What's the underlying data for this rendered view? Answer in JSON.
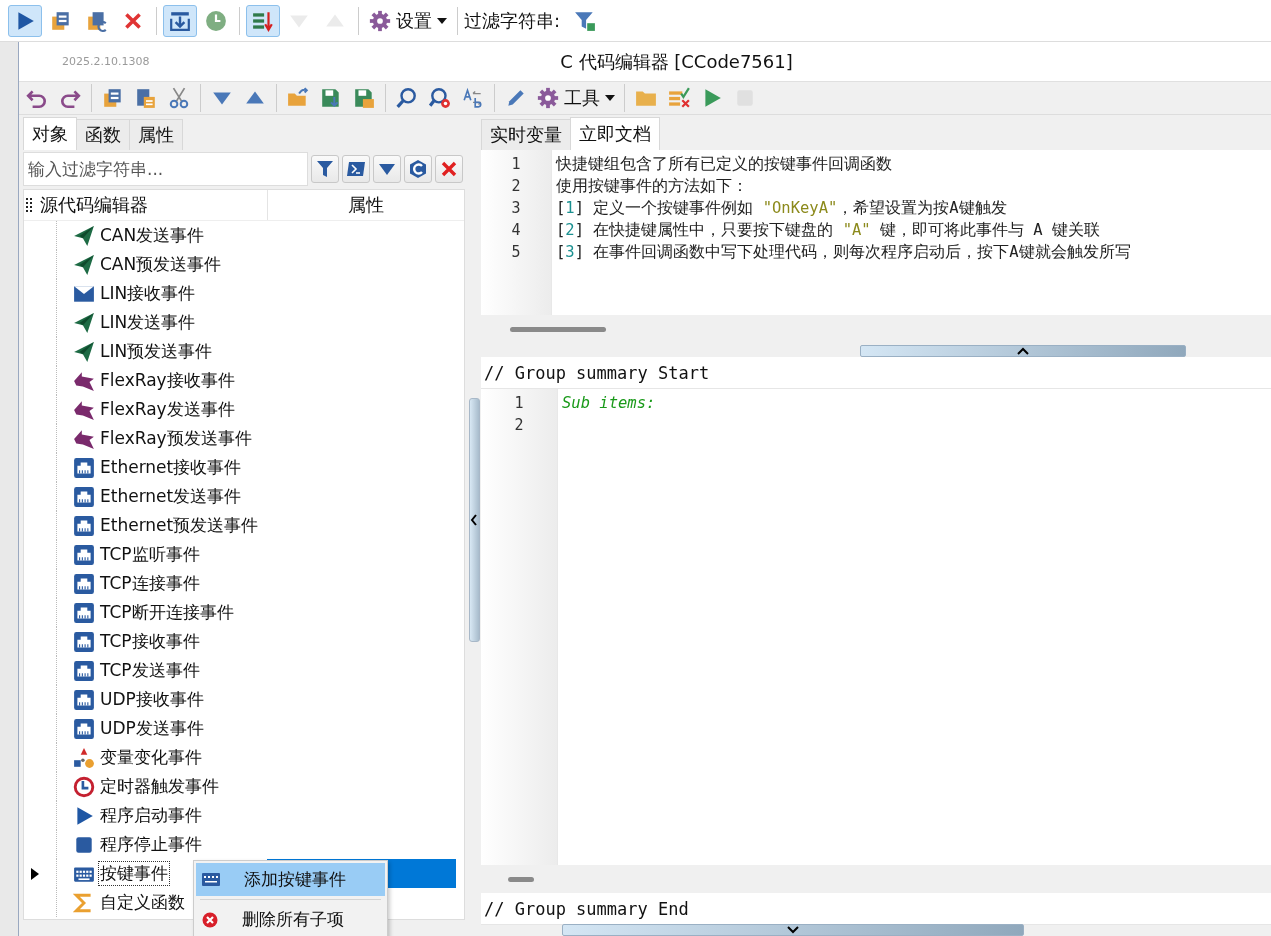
{
  "top_toolbar": {
    "buttons": [
      {
        "pressed": true,
        "disabled": false
      },
      {
        "pressed": false,
        "disabled": false
      },
      {
        "pressed": false,
        "disabled": false
      },
      {
        "pressed": false,
        "disabled": false
      },
      {
        "pressed": true,
        "disabled": false
      },
      {
        "pressed": false,
        "disabled": false
      },
      {
        "pressed": true,
        "disabled": false
      },
      {
        "pressed": false,
        "disabled": true
      },
      {
        "pressed": false,
        "disabled": true
      }
    ],
    "settings_menu": "设置",
    "filter_label": "过滤字符串:"
  },
  "window": {
    "version": "2025.2.10.1308",
    "title": "C 代码编辑器 [CCode7561]"
  },
  "editor_toolbar": {
    "buttons": [
      {
        "disabled": false
      },
      {
        "disabled": false
      },
      {
        "disabled": false
      },
      {
        "disabled": false
      },
      {
        "disabled": false
      },
      {
        "disabled": false
      },
      {
        "disabled": false
      },
      {
        "disabled": false
      },
      {
        "disabled": false
      },
      {
        "disabled": false
      },
      {
        "disabled": false
      },
      {
        "disabled": false
      },
      {
        "disabled": false
      },
      {
        "disabled": false
      },
      {
        "disabled": false
      },
      {
        "disabled": false
      },
      {
        "disabled": false
      },
      {
        "disabled": true
      }
    ],
    "tools_menu": "工具"
  },
  "left_tabs": [
    {
      "label": "对象",
      "selected": true
    },
    {
      "label": "函数",
      "selected": false
    },
    {
      "label": "属性",
      "selected": false
    }
  ],
  "filter": {
    "placeholder": "输入过滤字符串..."
  },
  "tree": {
    "columns": [
      "源代码编辑器",
      "属性"
    ],
    "items": [
      {
        "label": "CAN发送事件",
        "kind": "send",
        "selected": false,
        "expandable": false
      },
      {
        "label": "CAN预发送事件",
        "kind": "send",
        "selected": false,
        "expandable": false
      },
      {
        "label": "LIN接收事件",
        "kind": "receive",
        "selected": false,
        "expandable": false
      },
      {
        "label": "LIN发送事件",
        "kind": "send",
        "selected": false,
        "expandable": false
      },
      {
        "label": "LIN预发送事件",
        "kind": "send",
        "selected": false,
        "expandable": false
      },
      {
        "label": "FlexRay接收事件",
        "kind": "flexray",
        "selected": false,
        "expandable": false
      },
      {
        "label": "FlexRay发送事件",
        "kind": "flexray",
        "selected": false,
        "expandable": false
      },
      {
        "label": "FlexRay预发送事件",
        "kind": "flexray",
        "selected": false,
        "expandable": false
      },
      {
        "label": "Ethernet接收事件",
        "kind": "network",
        "selected": false,
        "expandable": false
      },
      {
        "label": "Ethernet发送事件",
        "kind": "network",
        "selected": false,
        "expandable": false
      },
      {
        "label": "Ethernet预发送事件",
        "kind": "network",
        "selected": false,
        "expandable": false
      },
      {
        "label": "TCP监听事件",
        "kind": "network",
        "selected": false,
        "expandable": false
      },
      {
        "label": "TCP连接事件",
        "kind": "network",
        "selected": false,
        "expandable": false
      },
      {
        "label": "TCP断开连接事件",
        "kind": "network",
        "selected": false,
        "expandable": false
      },
      {
        "label": "TCP接收事件",
        "kind": "network",
        "selected": false,
        "expandable": false
      },
      {
        "label": "TCP发送事件",
        "kind": "network",
        "selected": false,
        "expandable": false
      },
      {
        "label": "UDP接收事件",
        "kind": "network",
        "selected": false,
        "expandable": false
      },
      {
        "label": "UDP发送事件",
        "kind": "network",
        "selected": false,
        "expandable": false
      },
      {
        "label": "变量变化事件",
        "kind": "variable",
        "selected": false,
        "expandable": false
      },
      {
        "label": "定时器触发事件",
        "kind": "timer",
        "selected": false,
        "expandable": false
      },
      {
        "label": "程序启动事件",
        "kind": "start",
        "selected": false,
        "expandable": false
      },
      {
        "label": "程序停止事件",
        "kind": "stop",
        "selected": false,
        "expandable": false
      },
      {
        "label": "按键事件",
        "kind": "keyboard",
        "selected": true,
        "expandable": true
      },
      {
        "label": "自定义函数",
        "kind": "function",
        "selected": false,
        "expandable": false
      }
    ]
  },
  "context_menu": [
    {
      "label": "添加按键事件",
      "kind": "add",
      "selected": true
    },
    {
      "label": "删除所有子项",
      "kind": "delete",
      "selected": false
    }
  ],
  "right_tabs": [
    {
      "label": "实时变量",
      "selected": false
    },
    {
      "label": "立即文档",
      "selected": true
    }
  ],
  "document": [
    {
      "number": "1",
      "segments": [
        {
          "text": "快捷键组包含了所有已定义的按键事件回调函数",
          "kind": "text"
        }
      ]
    },
    {
      "number": "2",
      "segments": [
        {
          "text": "使用按键事件的方法如下：",
          "kind": "text"
        }
      ]
    },
    {
      "number": "3",
      "segments": [
        {
          "text": "[",
          "kind": "text"
        },
        {
          "text": "1",
          "kind": "number"
        },
        {
          "text": "] 定义一个按键事件例如 ",
          "kind": "text"
        },
        {
          "text": "\"OnKeyA\"",
          "kind": "string"
        },
        {
          "text": "，希望设置为按A键触发",
          "kind": "text"
        }
      ]
    },
    {
      "number": "4",
      "segments": [
        {
          "text": "[",
          "kind": "text"
        },
        {
          "text": "2",
          "kind": "number"
        },
        {
          "text": "] 在快捷键属性中，只要按下键盘的 ",
          "kind": "text"
        },
        {
          "text": "\"A\"",
          "kind": "string"
        },
        {
          "text": " 键，即可将此事件与 A 键关联",
          "kind": "text"
        }
      ]
    },
    {
      "number": "5",
      "segments": [
        {
          "text": "[",
          "kind": "text"
        },
        {
          "text": "3",
          "kind": "number"
        },
        {
          "text": "] 在事件回调函数中写下处理代码，则每次程序启动后，按下A键就会触发所写",
          "kind": "text"
        }
      ]
    }
  ],
  "group": {
    "start": "// Group summary Start",
    "lines": [
      {
        "number": "1",
        "text": "Sub items:",
        "kind": "comment"
      },
      {
        "number": "2"
      }
    ],
    "end": "// Group summary End"
  }
}
